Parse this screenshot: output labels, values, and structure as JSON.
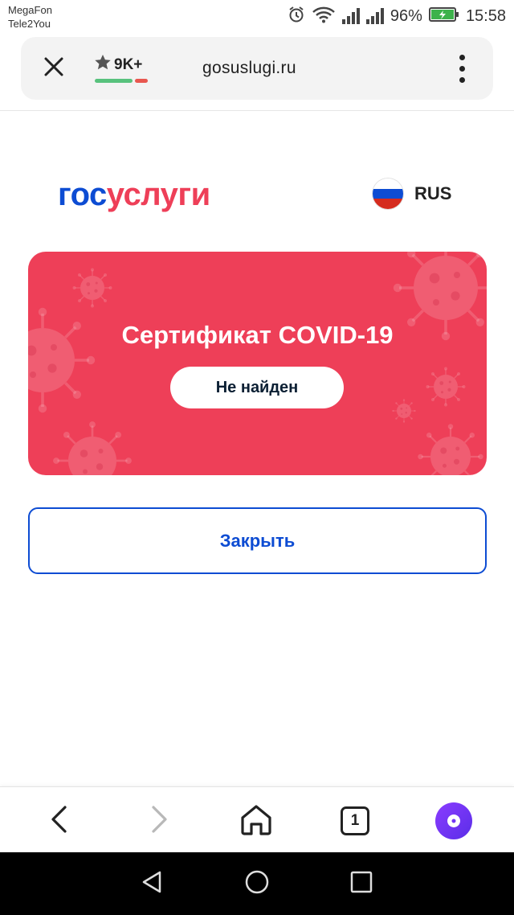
{
  "status_bar": {
    "carrier_1": "MegaFon",
    "carrier_2": "Tele2You",
    "battery_percent": "96%",
    "time": "15:58",
    "icons": [
      "alarm-icon",
      "wifi-icon",
      "signal-icon",
      "signal-icon",
      "battery-charging-icon"
    ]
  },
  "browser": {
    "url": "gosuslugi.ru",
    "rating_label": "9K+",
    "rating_positive_fraction": 0.75,
    "tabs_count": "1",
    "icons": [
      "close-icon",
      "star-icon",
      "more-vert-icon",
      "back-icon",
      "forward-icon",
      "home-icon",
      "alice-icon"
    ]
  },
  "header": {
    "logo_part_1": "гос",
    "logo_part_2": "услуги",
    "language": "RUS"
  },
  "covid_card": {
    "title": "Сертификат COVID-19",
    "status": "Не найден"
  },
  "actions": {
    "close_label": "Закрыть"
  },
  "colors": {
    "brand_blue": "#0d4cd3",
    "brand_red": "#ee3f58",
    "status_text": "#0b1f33",
    "alice_purple": "#7a35ff"
  }
}
